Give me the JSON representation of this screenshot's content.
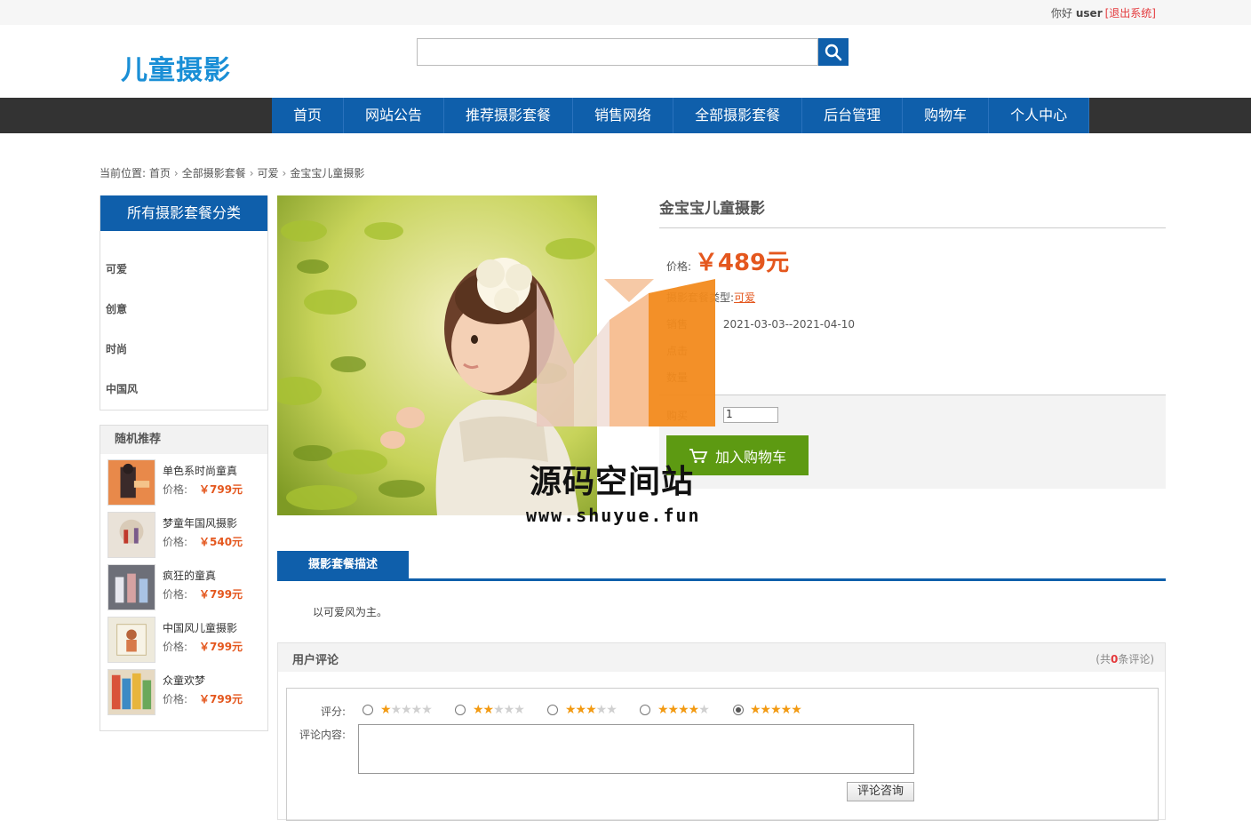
{
  "topbar": {
    "greeting": "你好",
    "username": "user",
    "logout": "[退出系统]"
  },
  "header": {
    "logo": "儿童摄影",
    "search_placeholder": ""
  },
  "nav": [
    "首页",
    "网站公告",
    "推荐摄影套餐",
    "销售网络",
    "全部摄影套餐",
    "后台管理",
    "购物车",
    "个人中心"
  ],
  "breadcrumb": {
    "prefix": "当前位置:",
    "items": [
      "首页",
      "全部摄影套餐",
      "可爱",
      "金宝宝儿童摄影"
    ]
  },
  "sidebar": {
    "category_title": "所有摄影套餐分类",
    "categories": [
      "可爱",
      "创意",
      "时尚",
      "中国风"
    ],
    "random_title": "随机推荐",
    "price_label": "价格:",
    "random_items": [
      {
        "name": "单色系时尚童真",
        "price": "￥799元"
      },
      {
        "name": "梦童年国风摄影",
        "price": "￥540元"
      },
      {
        "name": "疯狂的童真",
        "price": "￥799元"
      },
      {
        "name": "中国风儿童摄影",
        "price": "￥799元"
      },
      {
        "name": "众童欢梦",
        "price": "￥799元"
      }
    ]
  },
  "product": {
    "title": "金宝宝儿童摄影",
    "price_label": "价格:",
    "price": "￥489元",
    "category_label": "摄影套餐类型:",
    "category": "可爱",
    "sale_label": "销售",
    "sale_period": "2021-03-03--2021-04-10",
    "clicks_label": "点击",
    "quantity_label": "数量",
    "buy_label": "购买",
    "buy_qty": "1",
    "cart_button": "加入购物车"
  },
  "watermark": {
    "text": "源码空间站",
    "url": "www.shuyue.fun"
  },
  "description": {
    "tab": "摄影套餐描述",
    "text": "以可爱风为主。"
  },
  "comments": {
    "title": "用户评论",
    "count_prefix": "(共",
    "count": "0",
    "count_suffix": "条评论)",
    "rating_label": "评分:",
    "content_label": "评论内容:",
    "ratings": [
      1,
      2,
      3,
      4,
      5
    ],
    "selected_rating": 5,
    "submit": "评论咨询"
  },
  "colors": {
    "primary": "#0f5fab",
    "accent": "#e4571e",
    "cart": "#5d9a12",
    "nav_bg": "#333333"
  }
}
